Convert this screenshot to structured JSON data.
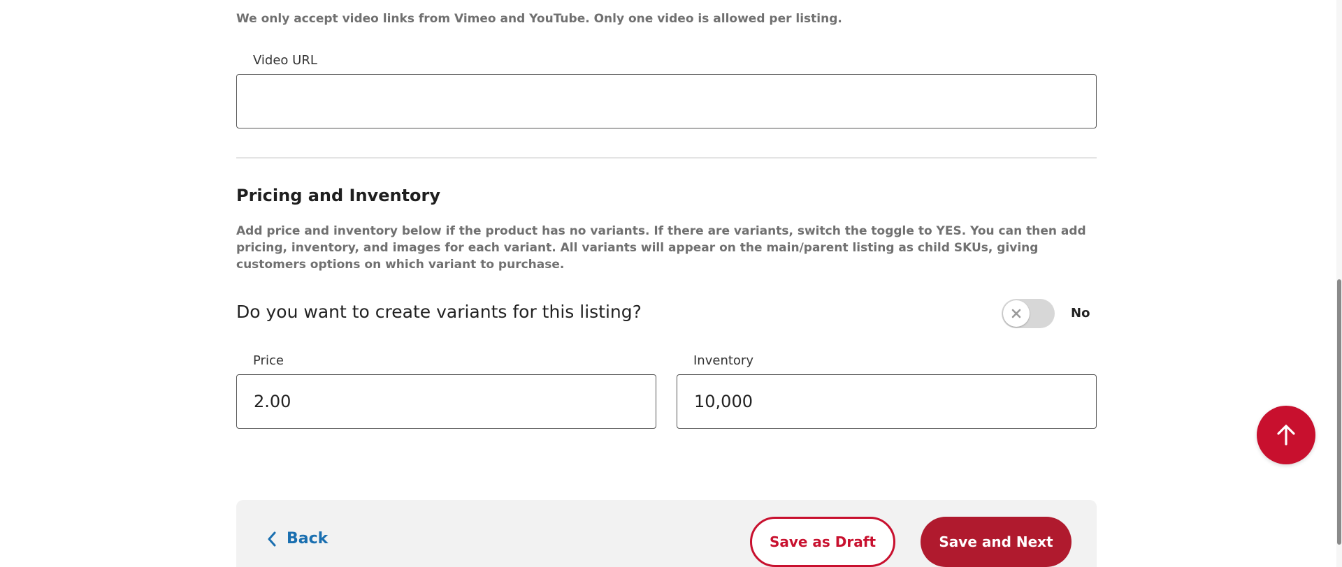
{
  "video": {
    "hint": "We only accept video links from Vimeo and YouTube. Only one video is allowed per listing.",
    "label": "Video URL",
    "value": ""
  },
  "pricing": {
    "title": "Pricing and Inventory",
    "description": "Add price and inventory below if the product has no variants. If there are variants, switch the toggle to YES. You can then add pricing, inventory, and images for each variant. All variants will appear on the main/parent listing as child SKUs, giving customers options on which variant to purchase.",
    "variants_question": "Do you want to create variants for this listing?",
    "variants_toggle_state": "No",
    "price": {
      "label": "Price",
      "value": "2.00"
    },
    "inventory": {
      "label": "Inventory",
      "value": "10,000"
    }
  },
  "footer": {
    "back_label": "Back",
    "save_draft_label": "Save as Draft",
    "save_next_label": "Save and Next"
  },
  "colors": {
    "brand_red": "#c8102e",
    "primary_button": "#b01a2e",
    "link_blue": "#1a6fb0"
  },
  "icons": {
    "back": "chevron-left-icon",
    "toggle_off": "close-icon",
    "scroll_top": "arrow-up-icon"
  }
}
